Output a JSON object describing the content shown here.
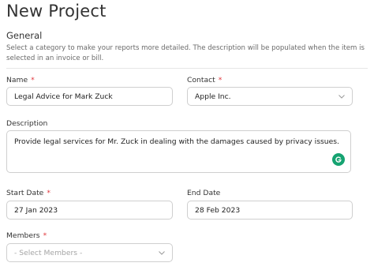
{
  "page": {
    "title": "New Project"
  },
  "general": {
    "title": "General",
    "description": "Select a category to make your reports more detailed. The description will be populated when the item is selected in an invoice or bill."
  },
  "fields": {
    "name": {
      "label": "Name",
      "required_mark": "*",
      "value": "Legal Advice for Mark Zuck"
    },
    "contact": {
      "label": "Contact",
      "required_mark": "*",
      "value": "Apple Inc.",
      "icon": "chevron-down-icon"
    },
    "description": {
      "label": "Description",
      "value": "Provide legal services for Mr. Zuck in dealing with the damages caused by privacy issues.",
      "assistant_icon": "grammarly-icon"
    },
    "start_date": {
      "label": "Start Date",
      "required_mark": "*",
      "value": "27 Jan 2023"
    },
    "end_date": {
      "label": "End Date",
      "value": "28 Feb 2023"
    },
    "members": {
      "label": "Members",
      "required_mark": "*",
      "placeholder": "- Select Members -",
      "icon": "chevron-down-icon"
    }
  },
  "colors": {
    "required": "#e0353b",
    "grammarly": "#15a371",
    "border": "#cfcfcf"
  }
}
